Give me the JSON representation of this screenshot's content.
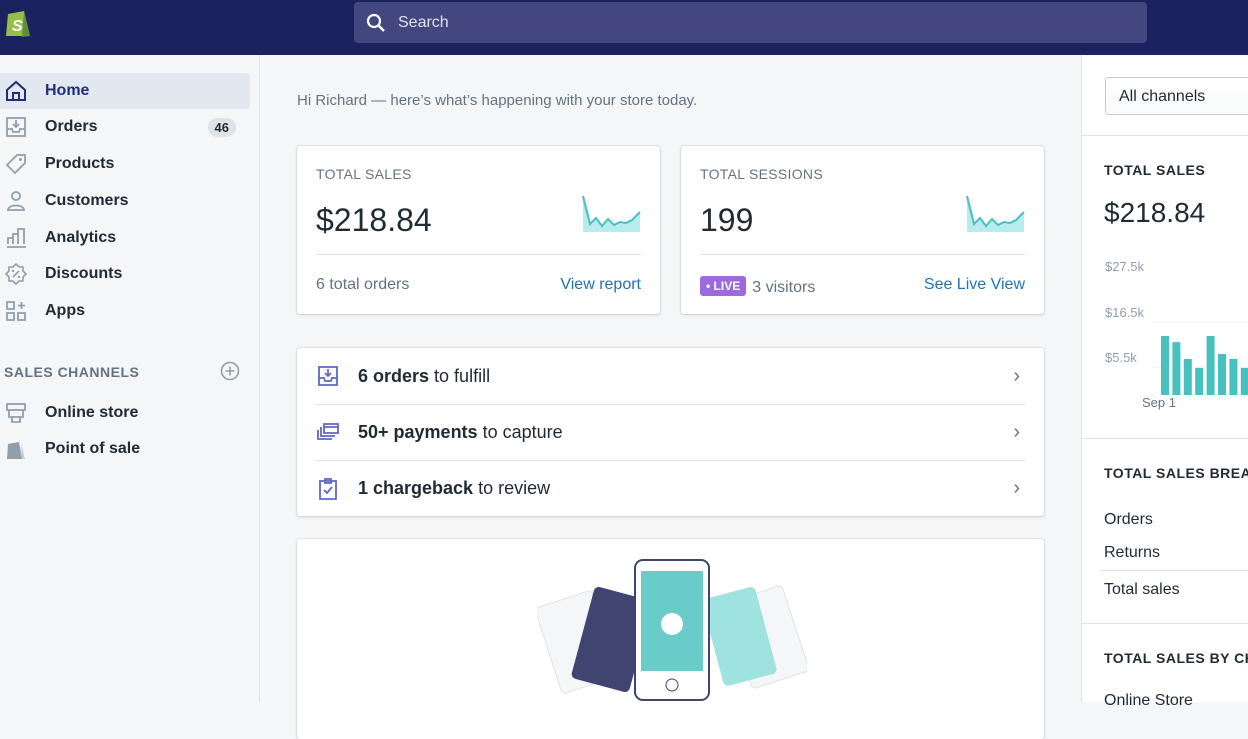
{
  "topbar": {
    "search_placeholder": "Search",
    "logo": "shopify-bag-logo"
  },
  "sidebar": {
    "items": [
      {
        "label": "Home",
        "icon": "home-icon",
        "active": true
      },
      {
        "label": "Orders",
        "icon": "orders-icon",
        "badge": "46"
      },
      {
        "label": "Products",
        "icon": "tag-icon"
      },
      {
        "label": "Customers",
        "icon": "person-icon"
      },
      {
        "label": "Analytics",
        "icon": "bar-chart-icon"
      },
      {
        "label": "Discounts",
        "icon": "discount-icon"
      },
      {
        "label": "Apps",
        "icon": "apps-icon"
      }
    ],
    "sales_channels_label": "SALES CHANNELS",
    "channels": [
      {
        "label": "Online store",
        "icon": "store-icon"
      },
      {
        "label": "Point of sale",
        "icon": "pos-icon"
      }
    ]
  },
  "main": {
    "greeting": "Hi Richard — here’s what’s happening with your store today.",
    "cards": [
      {
        "title": "TOTAL SALES",
        "value": "$218.84",
        "footer": "6 total orders",
        "link": "View report"
      },
      {
        "title": "TOTAL SESSIONS",
        "value": "199",
        "live_badge": "• LIVE",
        "footer": "3 visitors",
        "link": "See Live View"
      }
    ],
    "tasks": [
      {
        "bold": "6 orders",
        "rest": " to fulfill",
        "icon": "inbox-icon"
      },
      {
        "bold": "50+ payments",
        "rest": " to capture",
        "icon": "payments-icon"
      },
      {
        "bold": "1 chargeback",
        "rest": " to review",
        "icon": "clipboard-icon"
      }
    ]
  },
  "right": {
    "channel_select": "All channels",
    "total_sales_title": "TOTAL SALES",
    "total_sales_value": "$218.84",
    "breakdown_title": "TOTAL SALES BREAK",
    "breakdown_rows": [
      "Orders",
      "Returns",
      "Total sales"
    ],
    "by_channel_title": "TOTAL SALES BY CHA",
    "by_channel_first": "Online Store"
  },
  "chart_data": {
    "type": "bar",
    "x_ticks": [
      "Sep 1"
    ],
    "y_ticks": [
      "$27.5k",
      "$16.5k",
      "$5.5k"
    ],
    "ylim": [
      0,
      27.5
    ],
    "values_k": [
      24.2,
      22.7,
      18.6,
      16.4,
      24.2,
      19.8,
      18.6,
      16.4,
      14.5
    ],
    "color": "#47c1bf",
    "grid": true
  },
  "colors": {
    "topbar": "#1c2260",
    "accent": "#47c1bf",
    "link": "#1f73b7",
    "live": "#9c6ade"
  }
}
